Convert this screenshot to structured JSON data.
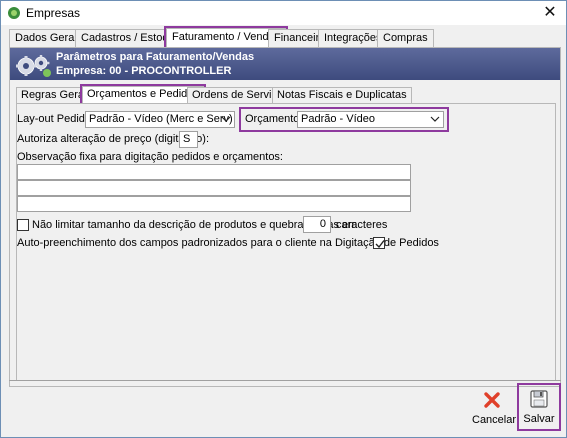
{
  "window": {
    "title": "Empresas",
    "close_symbol": "✕"
  },
  "top_tabs": [
    {
      "label": "Dados Gerais"
    },
    {
      "label": "Cadastros / Estoque"
    },
    {
      "label": "Faturamento / Vendas",
      "active": true
    },
    {
      "label": "Financeiro"
    },
    {
      "label": "Integrações"
    },
    {
      "label": "Compras"
    }
  ],
  "header": {
    "line1": "Parâmetros para Faturamento/Vendas",
    "line2": "Empresa: 00 - PROCONTROLLER",
    "icon": "gears-icon"
  },
  "sub_tabs": [
    {
      "label": "Regras Gerais"
    },
    {
      "label": "Orçamentos e Pedidos",
      "active": true
    },
    {
      "label": "Ordens de Serviços"
    },
    {
      "label": "Notas Fiscais e Duplicatas"
    }
  ],
  "form": {
    "layout_pedido_label": "Lay-out Pedido:",
    "layout_pedido_value": "Padrão - Vídeo (Merc e Serv)",
    "orcamento_label": "Orçamento:",
    "orcamento_value": "Padrão - Vídeo",
    "autoriza_label": "Autoriza alteração de preço (digitação):",
    "autoriza_value": "S",
    "observacao_label": "Observação fixa para digitação pedidos e orçamentos:",
    "nao_limitar_label": "Não limitar tamanho da descrição de produtos e quebrar linhas em",
    "nao_limitar_checked": false,
    "caracteres_value": "0",
    "caracteres_label": "caracteres",
    "auto_preench_label": "Auto-preenchimento dos campos padronizados para o cliente na Digitação de Pedidos",
    "auto_preench_checked": true
  },
  "actions": {
    "cancel_label": "Cancelar",
    "save_label": "Salvar"
  },
  "colors": {
    "highlight": "#8e3a9e",
    "header_band": "#4a5688",
    "cancel_icon": "#e0402a"
  }
}
